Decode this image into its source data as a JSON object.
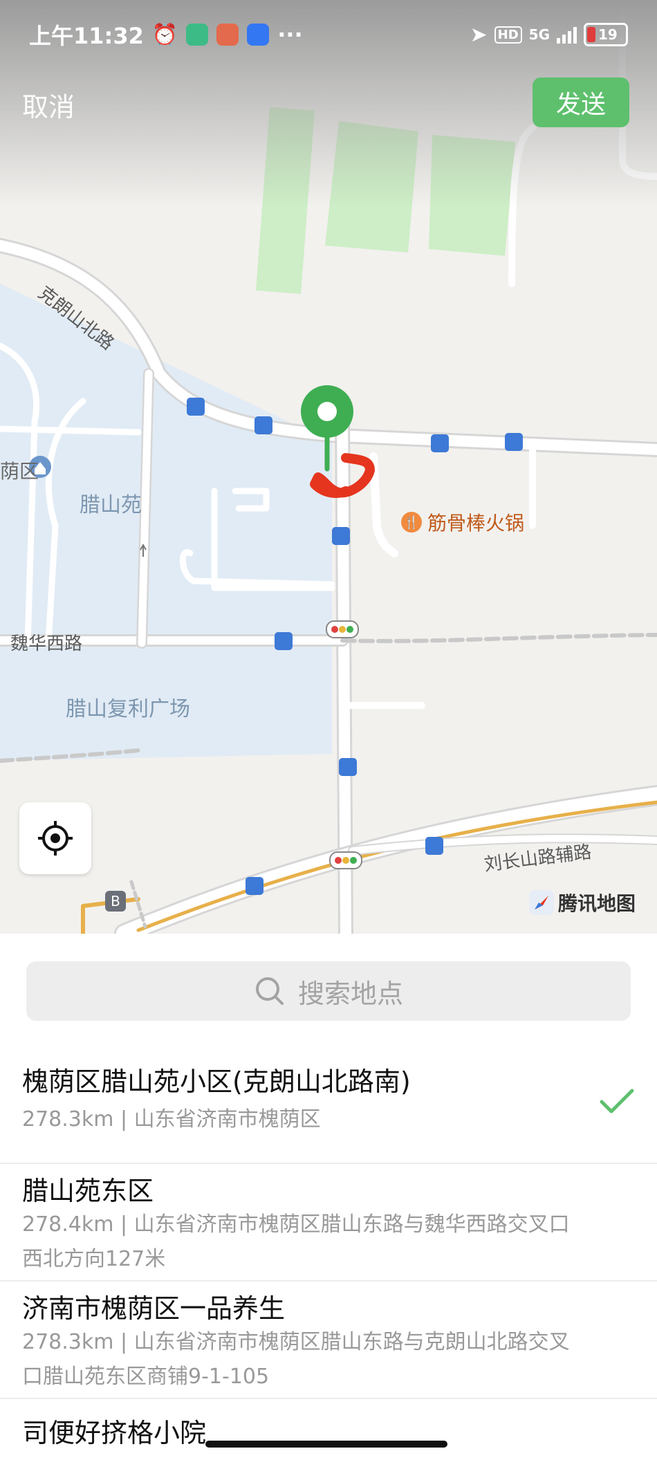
{
  "statusbar": {
    "time": "上午11:32",
    "dots": "···",
    "network": "5G",
    "hd": "HD",
    "battery": "19"
  },
  "header": {
    "cancel_label": "取消",
    "send_label": "发送"
  },
  "map": {
    "labels": {
      "road_north": "克朗山北路",
      "community": "腊山苑",
      "road_weihua": "魏华西路",
      "plaza": "腊山复利广场",
      "road_liuchang": "刘长山路辅路",
      "district_partial": "荫区"
    },
    "poi_restaurant": "筋骨棒火锅",
    "brand": "腾讯地图",
    "bus_stop_b": "B"
  },
  "search": {
    "placeholder": "搜索地点"
  },
  "results": [
    {
      "name": "槐荫区腊山苑小区(克朗山北路南)",
      "address": "278.3km | 山东省济南市槐荫区",
      "selected": true
    },
    {
      "name": "腊山苑东区",
      "address": "278.4km | 山东省济南市槐荫区腊山东路与魏华西路交叉口西北方向127米",
      "selected": false
    },
    {
      "name": "济南市槐荫区一品养生",
      "address": "278.3km | 山东省济南市槐荫区腊山东路与克朗山北路交叉口腊山苑东区商铺9-1-105",
      "selected": false
    },
    {
      "name": "司便好挤格小院",
      "address": "",
      "selected": false
    }
  ],
  "colors": {
    "accent": "#5ec06d",
    "pin": "#3fae52",
    "annotation": "#e5351f"
  }
}
